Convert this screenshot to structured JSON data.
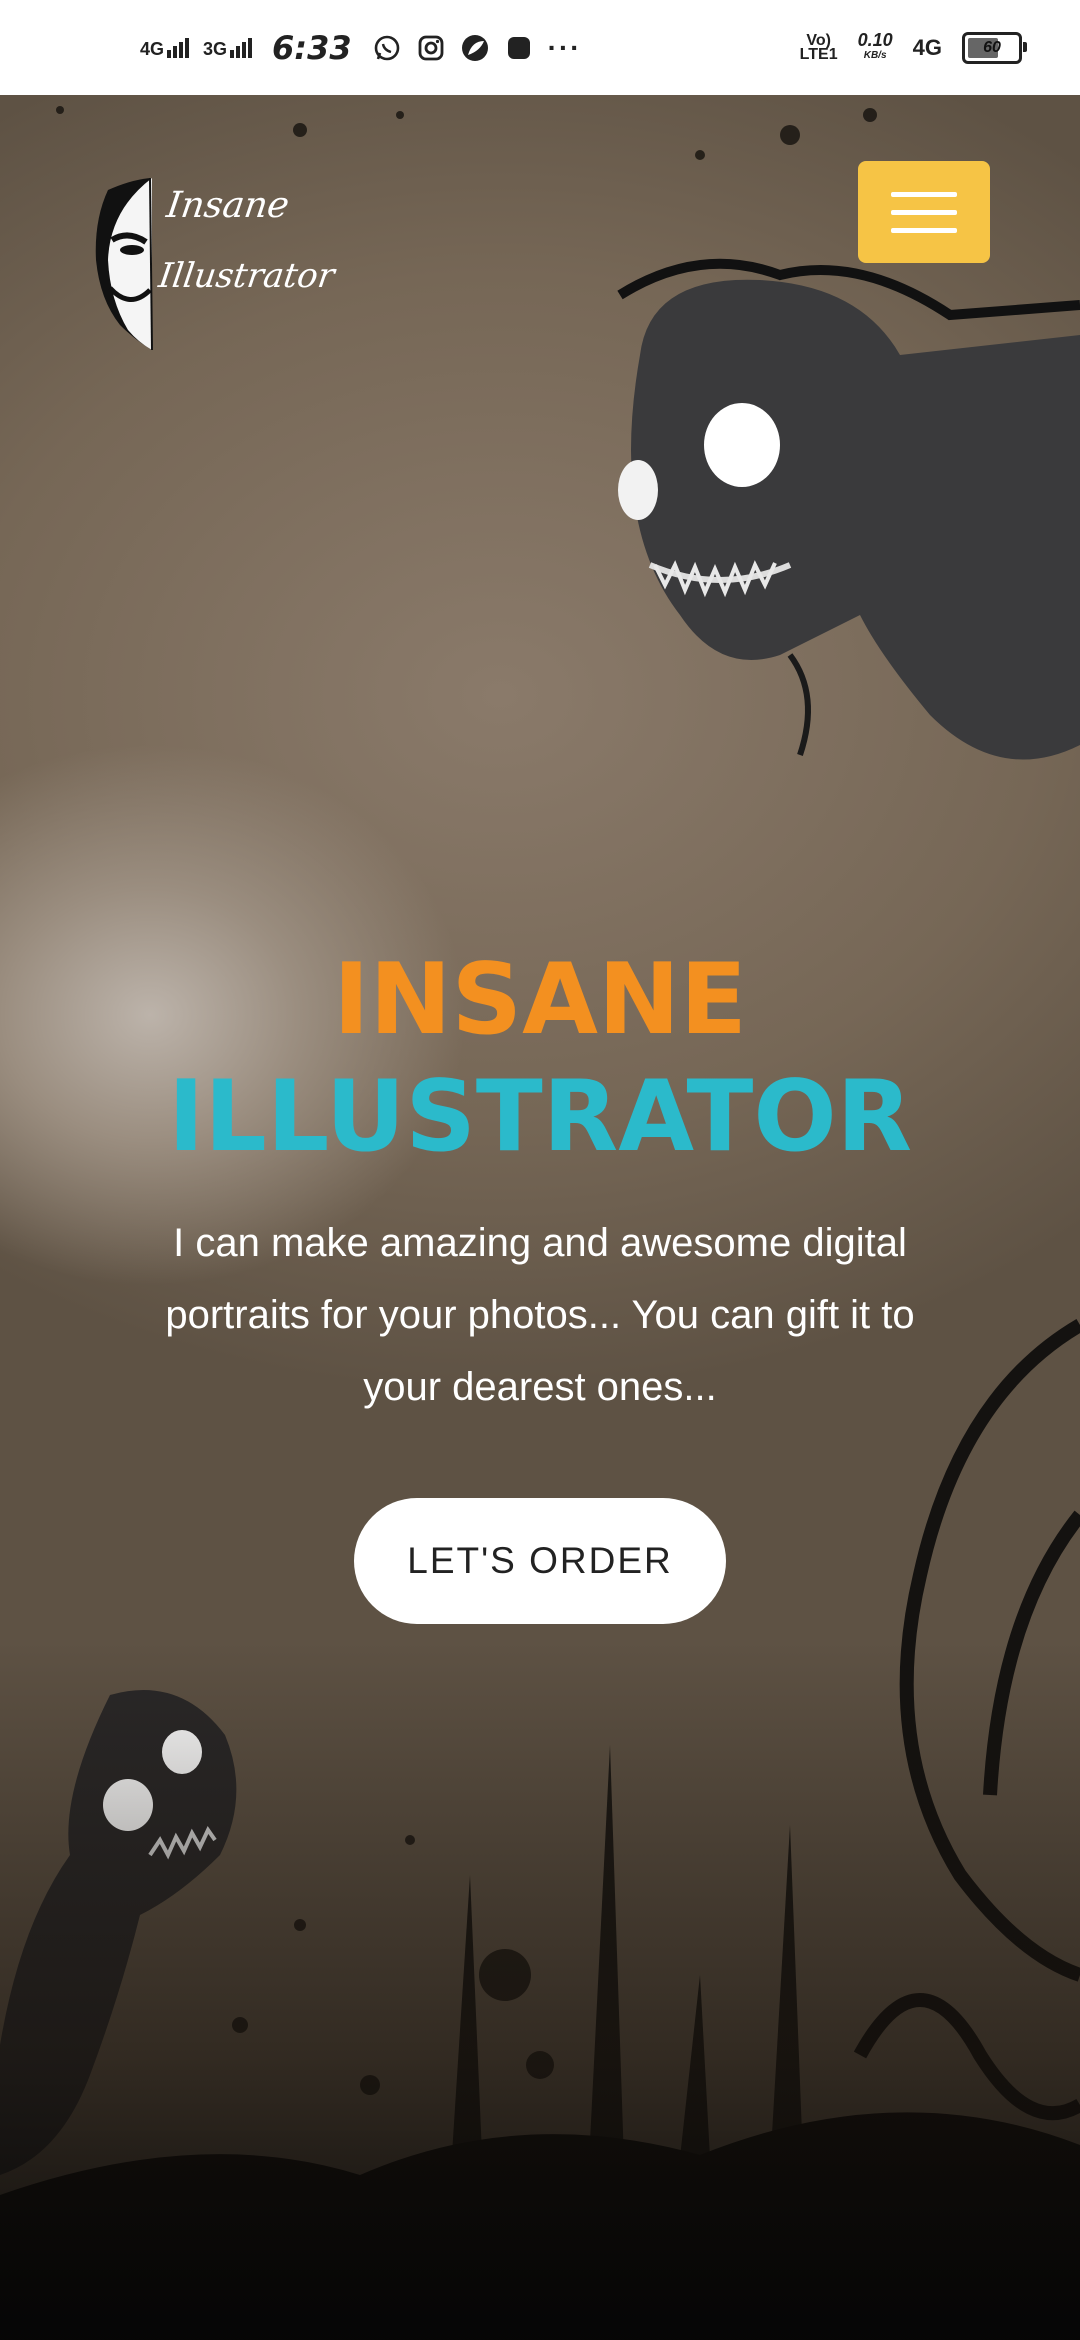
{
  "status_bar": {
    "network_1": "4G",
    "network_2": "3G",
    "time": "6:33",
    "icons": [
      "whatsapp-icon",
      "instagram-icon",
      "leaf-icon",
      "app-icon"
    ],
    "overflow": "···",
    "volte_top": "Vo)",
    "volte_bottom": "LTE1",
    "speed_value": "0.10",
    "speed_unit": "KB/s",
    "network_3": "4G",
    "battery": "60"
  },
  "logo": {
    "line1": "Insane",
    "line2": "Illustrator"
  },
  "hero": {
    "title_line1": "INSANE",
    "title_line2": "ILLUSTRATOR",
    "description": "I can make amazing and awesome digital portraits for your photos... You can gift it to your dearest ones...",
    "cta_label": "LET'S ORDER"
  },
  "colors": {
    "accent_orange": "#f39020",
    "accent_cyan": "#2bbacb",
    "menu_yellow": "#f6c445"
  }
}
